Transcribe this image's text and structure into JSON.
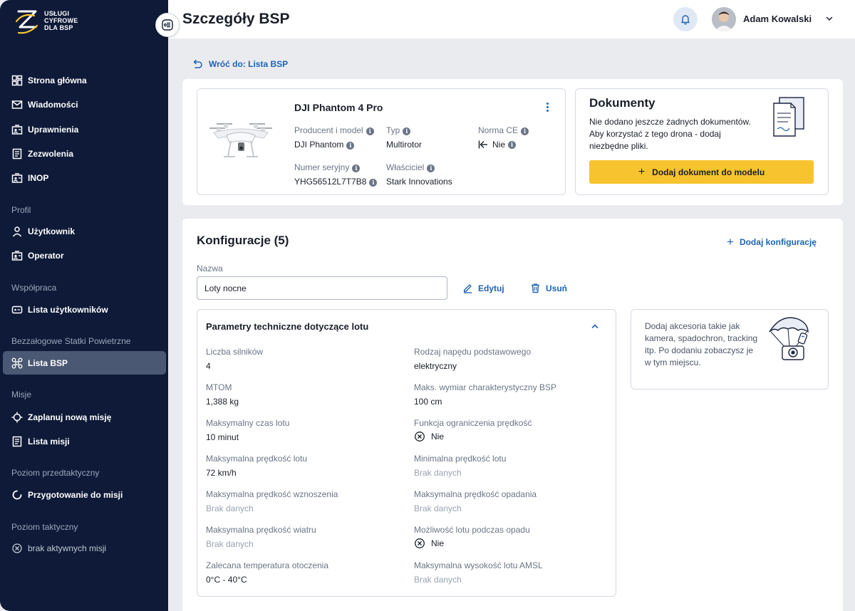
{
  "logo": {
    "line1": "USŁUGI",
    "line2": "CYFROWE",
    "line3": "DLA BSP"
  },
  "header": {
    "title": "Szczegóły BSP",
    "user_name": "Adam Kowalski"
  },
  "sidebar": {
    "items": [
      {
        "label": "Strona główna",
        "icon": "dashboard-icon"
      },
      {
        "label": "Wiadomości",
        "icon": "mail-icon"
      },
      {
        "label": "Uprawnienia",
        "icon": "id-card-icon"
      },
      {
        "label": "Zezwolenia",
        "icon": "document-icon"
      },
      {
        "label": "INOP",
        "icon": "id-card-icon"
      }
    ],
    "sections": {
      "profil": "Profil",
      "wspolpraca": "Współpraca",
      "bezzalogowe": "Bezzałogowe Statki Powietrzne",
      "misje": "Misje",
      "przedtaktyczny": "Poziom przedtaktyczny",
      "taktyczny": "Poziom taktyczny"
    },
    "profil_items": [
      {
        "label": "Użytkownik"
      },
      {
        "label": "Operator"
      }
    ],
    "wspolpraca_items": [
      {
        "label": "Lista użytkowników"
      }
    ],
    "bsp_items": [
      {
        "label": "Lista BSP"
      }
    ],
    "misje_items": [
      {
        "label": "Zaplanuj nową misję"
      },
      {
        "label": "Lista misji"
      }
    ],
    "przedtaktyczny_items": [
      {
        "label": "Przygotowanie do misji"
      }
    ],
    "taktyczny_items": [
      {
        "label": "brak aktywnych misji"
      }
    ]
  },
  "back_link": "Wróć do: Lista BSP",
  "drone": {
    "name": "DJI Phantom 4 Pro",
    "producer_label": "Producent i model",
    "producer_value": "DJI Phantom",
    "type_label": "Typ",
    "type_value": "Multirotor",
    "ce_label": "Norma CE",
    "ce_value": "Nie",
    "serial_label": "Numer seryjny",
    "serial_value": "YHG56512L7T7B8",
    "owner_label": "Właściciel",
    "owner_value": "Stark Innovations"
  },
  "documents": {
    "title": "Dokumenty",
    "text": "Nie dodano jeszcze żadnych dokumentów. Aby korzystać z tego drona - dodaj niezbędne pliki.",
    "button": "Dodaj dokument do modelu"
  },
  "config": {
    "title": "Konfiguracje (5)",
    "add_label": "Dodaj konfigurację",
    "name_label": "Nazwa",
    "name_value": "Loty nocne",
    "edit_label": "Edytuj",
    "delete_label": "Usuń"
  },
  "params": {
    "title": "Parametry techniczne dotyczące lotu",
    "left": [
      {
        "label": "Liczba silników",
        "value": "4"
      },
      {
        "label": "MTOM",
        "value": "1,388 kg"
      },
      {
        "label": "Maksymalny czas lotu",
        "value": "10 minut"
      },
      {
        "label": "Maksymalna prędkość lotu",
        "value": "72 km/h"
      },
      {
        "label": "Maksymalna prędkość wznoszenia",
        "value": "Brak danych"
      },
      {
        "label": "Maksymalna prędkość wiatru",
        "value": "Brak danych"
      },
      {
        "label": "Zalecana temperatura otoczenia",
        "value": "0°C - 40°C"
      }
    ],
    "right": [
      {
        "label": "Rodzaj napędu podstawowego",
        "value": "elektryczny"
      },
      {
        "label": "Maks. wymiar charakterystyczny BSP",
        "value": "100 cm"
      },
      {
        "label": "Funkcja ograniczenia prędkość",
        "value": "Nie"
      },
      {
        "label": "Minimalna prędkość lotu",
        "value": "Brak danych"
      },
      {
        "label": "Maksymalna prędkość opadania",
        "value": "Brak danych"
      },
      {
        "label": "Możliwość lotu podczas opadu",
        "value": "Nie"
      },
      {
        "label": "Maksymalna wysokość lotu AMSL",
        "value": "Brak danych"
      }
    ]
  },
  "accessories": {
    "text": "Dodaj akcesoria takie jak kamera, spadochron, tracking itp. Po dodaniu zobaczysz je w tym miejscu."
  },
  "colors": {
    "sidebar_bg": "#0e1a37",
    "accent_blue": "#1e63b3",
    "button_yellow": "#f7c32e",
    "page_bg": "#e9ebef"
  }
}
